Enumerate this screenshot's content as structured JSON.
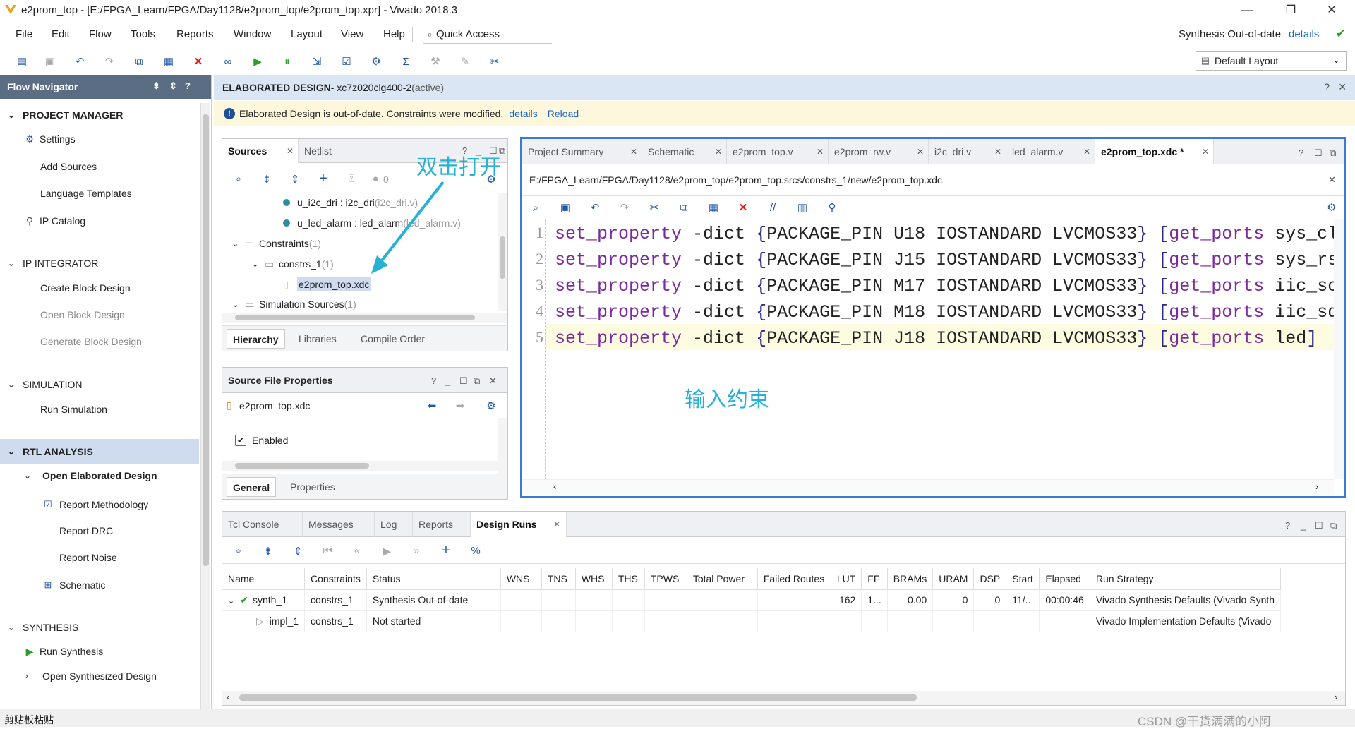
{
  "window": {
    "title": "e2prom_top - [E:/FPGA_Learn/FPGA/Day1128/e2prom_top/e2prom_top.xpr] - Vivado 2018.3",
    "minimize": "—",
    "maximize": "❐",
    "close": "✕"
  },
  "menu": {
    "items": [
      "File",
      "Edit",
      "Flow",
      "Tools",
      "Reports",
      "Window",
      "Layout",
      "View",
      "Help"
    ],
    "quick_access": "Quick Access"
  },
  "status_right": {
    "text": "Synthesis Out-of-date",
    "link": "details"
  },
  "layout_select": {
    "value": "Default Layout"
  },
  "flow_navigator": {
    "title": "Flow Navigator",
    "sections": [
      {
        "label": "PROJECT MANAGER"
      },
      {
        "label": "IP INTEGRATOR"
      },
      {
        "label": "SIMULATION"
      },
      {
        "label": "RTL ANALYSIS"
      },
      {
        "label": "SYNTHESIS"
      }
    ],
    "items": {
      "settings": "Settings",
      "add_sources": "Add Sources",
      "language_templates": "Language Templates",
      "ip_catalog": "IP Catalog",
      "create_block": "Create Block Design",
      "open_block": "Open Block Design",
      "generate_block": "Generate Block Design",
      "run_sim": "Run Simulation",
      "open_elab": "Open Elaborated Design",
      "report_method": "Report Methodology",
      "report_drc": "Report DRC",
      "report_noise": "Report Noise",
      "schematic": "Schematic",
      "run_synth": "Run Synthesis",
      "open_synth": "Open Synthesized Design"
    }
  },
  "elab_header": {
    "title": "ELABORATED DESIGN",
    "device": " - xc7z020clg400-2",
    "state": " (active)"
  },
  "warning": {
    "text": "Elaborated Design is out-of-date. Constraints were modified.",
    "details": "details",
    "reload": "Reload"
  },
  "sources": {
    "tabs": [
      "Sources",
      "Netlist"
    ],
    "count": "0",
    "tree": {
      "i2c_dri": "u_i2c_dri : i2c_dri",
      "i2c_dri_file": " (i2c_dri.v)",
      "led_alarm": "u_led_alarm : led_alarm",
      "led_alarm_file": " (led_alarm.v)",
      "constraints": "Constraints",
      "constraints_count": " (1)",
      "constrs_1": "constrs_1",
      "constrs_1_count": " (1)",
      "xdc": "e2prom_top.xdc",
      "sim": "Simulation Sources",
      "sim_count": " (1)"
    },
    "bottom_tabs": [
      "Hierarchy",
      "Libraries",
      "Compile Order"
    ]
  },
  "sfp": {
    "title": "Source File Properties",
    "file": "e2prom_top.xdc",
    "enabled": "Enabled",
    "tabs": [
      "General",
      "Properties"
    ]
  },
  "editor": {
    "tabs": [
      "Project Summary",
      "Schematic",
      "e2prom_top.v",
      "e2prom_rw.v",
      "i2c_dri.v",
      "led_alarm.v",
      "e2prom_top.xdc *"
    ],
    "path": "E:/FPGA_Learn/FPGA/Day1128/e2prom_top/e2prom_top.srcs/constrs_1/new/e2prom_top.xdc",
    "lines": [
      {
        "n": "1",
        "pin": "U18",
        "port": "sys_clk"
      },
      {
        "n": "2",
        "pin": "J15",
        "port": "sys_rst_n"
      },
      {
        "n": "3",
        "pin": "M17",
        "port": "iic_scl"
      },
      {
        "n": "4",
        "pin": "M18",
        "port": "iic_sda"
      },
      {
        "n": "5",
        "pin": "J18",
        "port": "led"
      }
    ],
    "kw_set": "set_property",
    "kw_dict": " -dict ",
    "kw_pkg": "PACKAGE_PIN",
    "kw_io": "IOSTANDARD LVCMOS33",
    "kw_get": "get_ports"
  },
  "annotations": {
    "open": "双击打开",
    "input": "输入约束"
  },
  "bottom": {
    "tabs": [
      "Tcl Console",
      "Messages",
      "Log",
      "Reports",
      "Design Runs"
    ],
    "columns": [
      "Name",
      "Constraints",
      "Status",
      "WNS",
      "TNS",
      "WHS",
      "THS",
      "TPWS",
      "Total Power",
      "Failed Routes",
      "LUT",
      "FF",
      "BRAMs",
      "URAM",
      "DSP",
      "Start",
      "Elapsed",
      "Run Strategy"
    ],
    "rows": [
      {
        "name": "synth_1",
        "constraints": "constrs_1",
        "status": "Synthesis Out-of-date",
        "lut": "162",
        "ff": "1...",
        "brams": "0.00",
        "uram": "0",
        "dsp": "0",
        "start": "11/...",
        "elapsed": "00:00:46",
        "strategy": "Vivado Synthesis Defaults (Vivado Synth"
      },
      {
        "name": "impl_1",
        "constraints": "constrs_1",
        "status": "Not started",
        "lut": "",
        "ff": "",
        "brams": "",
        "uram": "",
        "dsp": "",
        "start": "",
        "elapsed": "",
        "strategy": "Vivado Implementation Defaults (Vivado"
      }
    ]
  },
  "statusbar": {
    "left": "剪贴板粘贴",
    "watermark": "CSDN @干货满满的小阿"
  }
}
